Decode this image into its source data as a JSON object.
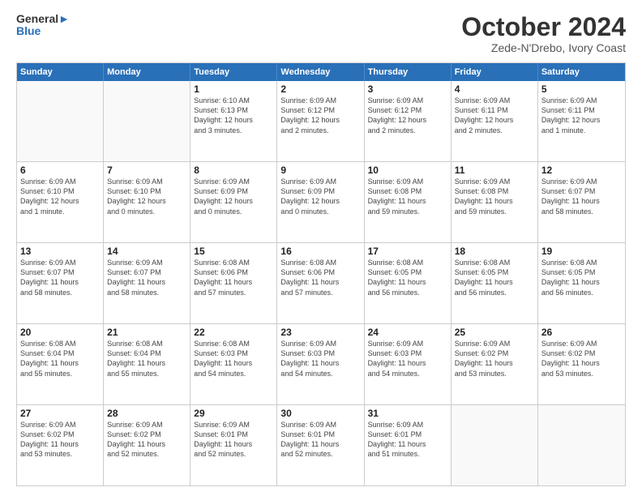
{
  "logo": {
    "line1": "General",
    "line2": "Blue"
  },
  "title": "October 2024",
  "subtitle": "Zede-N'Drebo, Ivory Coast",
  "weekdays": [
    "Sunday",
    "Monday",
    "Tuesday",
    "Wednesday",
    "Thursday",
    "Friday",
    "Saturday"
  ],
  "weeks": [
    [
      {
        "day": "",
        "info": ""
      },
      {
        "day": "",
        "info": ""
      },
      {
        "day": "1",
        "info": "Sunrise: 6:10 AM\nSunset: 6:13 PM\nDaylight: 12 hours\nand 3 minutes."
      },
      {
        "day": "2",
        "info": "Sunrise: 6:09 AM\nSunset: 6:12 PM\nDaylight: 12 hours\nand 2 minutes."
      },
      {
        "day": "3",
        "info": "Sunrise: 6:09 AM\nSunset: 6:12 PM\nDaylight: 12 hours\nand 2 minutes."
      },
      {
        "day": "4",
        "info": "Sunrise: 6:09 AM\nSunset: 6:11 PM\nDaylight: 12 hours\nand 2 minutes."
      },
      {
        "day": "5",
        "info": "Sunrise: 6:09 AM\nSunset: 6:11 PM\nDaylight: 12 hours\nand 1 minute."
      }
    ],
    [
      {
        "day": "6",
        "info": "Sunrise: 6:09 AM\nSunset: 6:10 PM\nDaylight: 12 hours\nand 1 minute."
      },
      {
        "day": "7",
        "info": "Sunrise: 6:09 AM\nSunset: 6:10 PM\nDaylight: 12 hours\nand 0 minutes."
      },
      {
        "day": "8",
        "info": "Sunrise: 6:09 AM\nSunset: 6:09 PM\nDaylight: 12 hours\nand 0 minutes."
      },
      {
        "day": "9",
        "info": "Sunrise: 6:09 AM\nSunset: 6:09 PM\nDaylight: 12 hours\nand 0 minutes."
      },
      {
        "day": "10",
        "info": "Sunrise: 6:09 AM\nSunset: 6:08 PM\nDaylight: 11 hours\nand 59 minutes."
      },
      {
        "day": "11",
        "info": "Sunrise: 6:09 AM\nSunset: 6:08 PM\nDaylight: 11 hours\nand 59 minutes."
      },
      {
        "day": "12",
        "info": "Sunrise: 6:09 AM\nSunset: 6:07 PM\nDaylight: 11 hours\nand 58 minutes."
      }
    ],
    [
      {
        "day": "13",
        "info": "Sunrise: 6:09 AM\nSunset: 6:07 PM\nDaylight: 11 hours\nand 58 minutes."
      },
      {
        "day": "14",
        "info": "Sunrise: 6:09 AM\nSunset: 6:07 PM\nDaylight: 11 hours\nand 58 minutes."
      },
      {
        "day": "15",
        "info": "Sunrise: 6:08 AM\nSunset: 6:06 PM\nDaylight: 11 hours\nand 57 minutes."
      },
      {
        "day": "16",
        "info": "Sunrise: 6:08 AM\nSunset: 6:06 PM\nDaylight: 11 hours\nand 57 minutes."
      },
      {
        "day": "17",
        "info": "Sunrise: 6:08 AM\nSunset: 6:05 PM\nDaylight: 11 hours\nand 56 minutes."
      },
      {
        "day": "18",
        "info": "Sunrise: 6:08 AM\nSunset: 6:05 PM\nDaylight: 11 hours\nand 56 minutes."
      },
      {
        "day": "19",
        "info": "Sunrise: 6:08 AM\nSunset: 6:05 PM\nDaylight: 11 hours\nand 56 minutes."
      }
    ],
    [
      {
        "day": "20",
        "info": "Sunrise: 6:08 AM\nSunset: 6:04 PM\nDaylight: 11 hours\nand 55 minutes."
      },
      {
        "day": "21",
        "info": "Sunrise: 6:08 AM\nSunset: 6:04 PM\nDaylight: 11 hours\nand 55 minutes."
      },
      {
        "day": "22",
        "info": "Sunrise: 6:08 AM\nSunset: 6:03 PM\nDaylight: 11 hours\nand 54 minutes."
      },
      {
        "day": "23",
        "info": "Sunrise: 6:09 AM\nSunset: 6:03 PM\nDaylight: 11 hours\nand 54 minutes."
      },
      {
        "day": "24",
        "info": "Sunrise: 6:09 AM\nSunset: 6:03 PM\nDaylight: 11 hours\nand 54 minutes."
      },
      {
        "day": "25",
        "info": "Sunrise: 6:09 AM\nSunset: 6:02 PM\nDaylight: 11 hours\nand 53 minutes."
      },
      {
        "day": "26",
        "info": "Sunrise: 6:09 AM\nSunset: 6:02 PM\nDaylight: 11 hours\nand 53 minutes."
      }
    ],
    [
      {
        "day": "27",
        "info": "Sunrise: 6:09 AM\nSunset: 6:02 PM\nDaylight: 11 hours\nand 53 minutes."
      },
      {
        "day": "28",
        "info": "Sunrise: 6:09 AM\nSunset: 6:02 PM\nDaylight: 11 hours\nand 52 minutes."
      },
      {
        "day": "29",
        "info": "Sunrise: 6:09 AM\nSunset: 6:01 PM\nDaylight: 11 hours\nand 52 minutes."
      },
      {
        "day": "30",
        "info": "Sunrise: 6:09 AM\nSunset: 6:01 PM\nDaylight: 11 hours\nand 52 minutes."
      },
      {
        "day": "31",
        "info": "Sunrise: 6:09 AM\nSunset: 6:01 PM\nDaylight: 11 hours\nand 51 minutes."
      },
      {
        "day": "",
        "info": ""
      },
      {
        "day": "",
        "info": ""
      }
    ]
  ]
}
